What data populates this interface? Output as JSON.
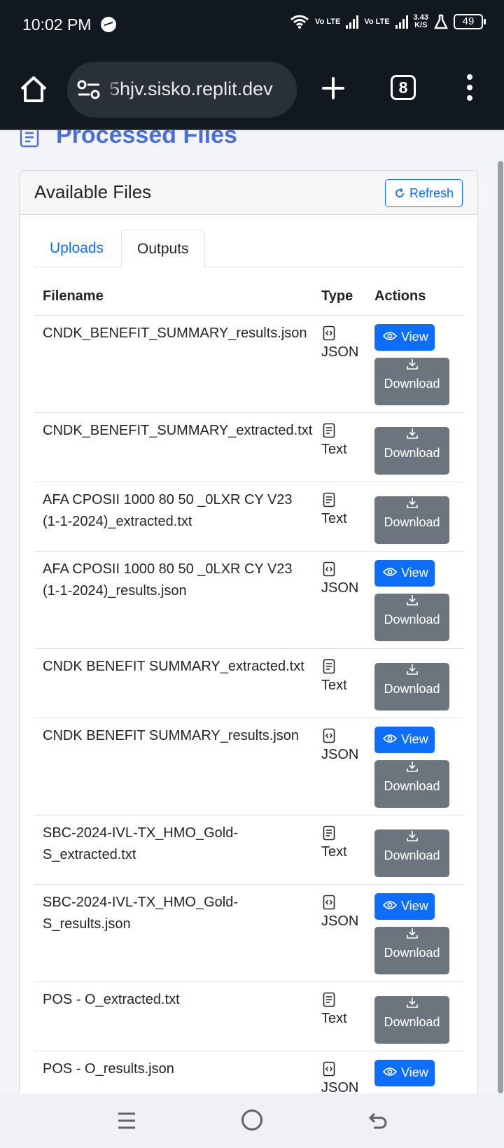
{
  "status_bar": {
    "time": "10:02 PM",
    "network_label": "Vo LTE",
    "speed_value": "3.43",
    "speed_unit": "K/S",
    "battery": "49"
  },
  "browser": {
    "url": "5hjv.sisko.replit.dev",
    "tab_count": "8"
  },
  "page": {
    "title": "Processed Files",
    "card_title": "Available Files",
    "refresh_label": "Refresh",
    "tabs": [
      {
        "label": "Uploads",
        "active": false
      },
      {
        "label": "Outputs",
        "active": true
      }
    ],
    "columns": {
      "filename": "Filename",
      "type": "Type",
      "actions": "Actions"
    },
    "view_label": "View",
    "download_label": "Download",
    "files": [
      {
        "filename": "CNDK_BENEFIT_SUMMARY_results.json",
        "type": "JSON",
        "icon": "json-file-icon"
      },
      {
        "filename": "CNDK_BENEFIT_SUMMARY_extracted.txt",
        "type": "Text",
        "icon": "text-file-icon"
      },
      {
        "filename": "AFA CPOSII 1000 80 50 _0LXR CY V23 (1-1-2024)_extracted.txt",
        "type": "Text",
        "icon": "text-file-icon"
      },
      {
        "filename": "AFA CPOSII 1000 80 50 _0LXR CY V23 (1-1-2024)_results.json",
        "type": "JSON",
        "icon": "json-file-icon"
      },
      {
        "filename": "CNDK BENEFIT SUMMARY_extracted.txt",
        "type": "Text",
        "icon": "text-file-icon"
      },
      {
        "filename": "CNDK BENEFIT SUMMARY_results.json",
        "type": "JSON",
        "icon": "json-file-icon"
      },
      {
        "filename": "SBC-2024-IVL-TX_HMO_Gold-S_extracted.txt",
        "type": "Text",
        "icon": "text-file-icon"
      },
      {
        "filename": "SBC-2024-IVL-TX_HMO_Gold-S_results.json",
        "type": "JSON",
        "icon": "json-file-icon"
      },
      {
        "filename": "POS - O_extracted.txt",
        "type": "Text",
        "icon": "text-file-icon"
      },
      {
        "filename": "POS - O_results.json",
        "type": "JSON",
        "icon": "json-file-icon"
      }
    ]
  },
  "colors": {
    "primary": "#0d6efd",
    "secondary": "#6c757d",
    "title": "#4a6fdc",
    "chrome": "#121820"
  }
}
